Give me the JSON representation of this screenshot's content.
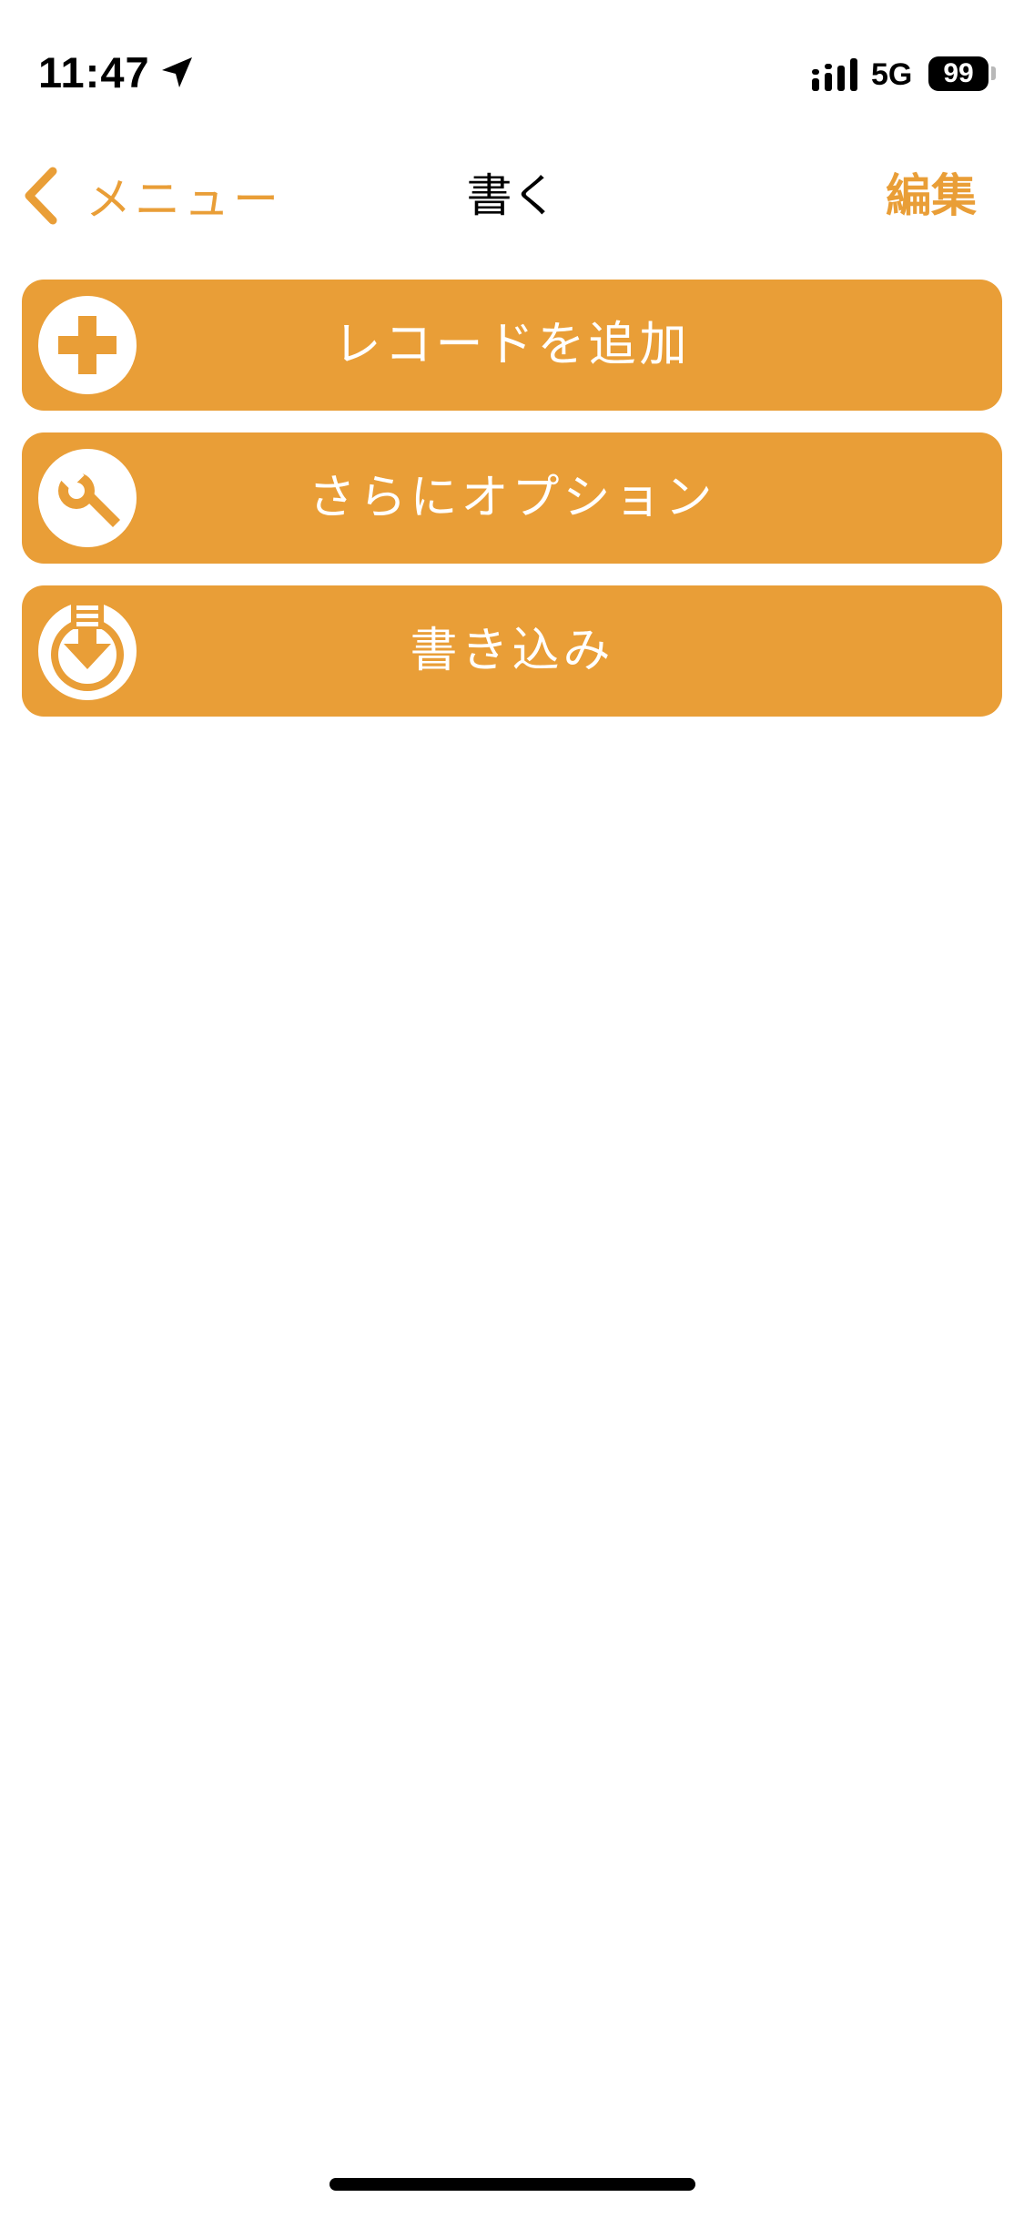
{
  "status_bar": {
    "time": "11:47",
    "network": "5G",
    "battery": "99",
    "icons": [
      "location-arrow-icon",
      "signal-icon"
    ]
  },
  "nav": {
    "back_label": "メニュー",
    "title": "書く",
    "edit_label": "編集"
  },
  "menu": {
    "items": [
      {
        "label": "レコードを追加",
        "icon": "plus-circle-icon"
      },
      {
        "label": "さらにオプション",
        "icon": "wrench-circle-icon"
      },
      {
        "label": "書き込み",
        "icon": "download-circle-icon"
      }
    ]
  },
  "colors": {
    "accent": "#e99e37",
    "background": "#ffffff",
    "text_primary": "#000000",
    "text_on_accent": "#ffffff"
  }
}
